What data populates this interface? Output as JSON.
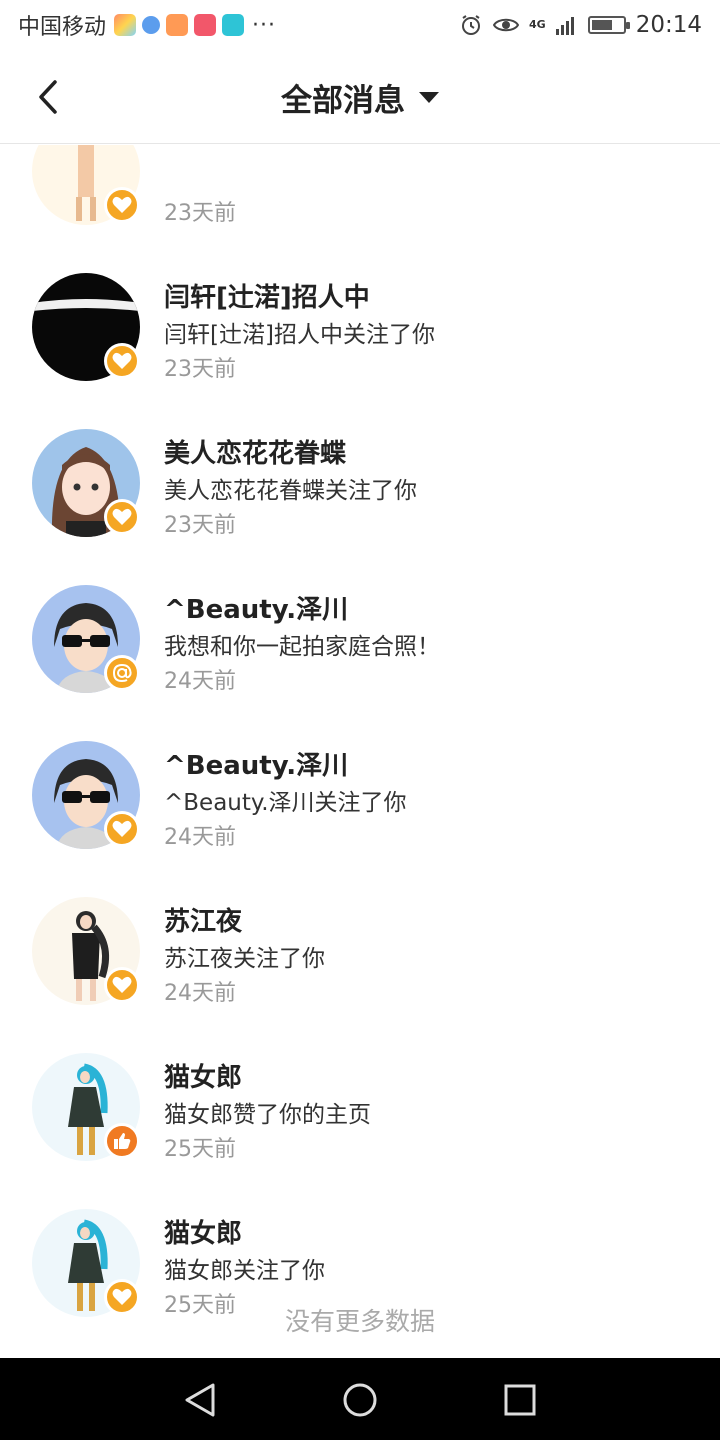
{
  "status_bar": {
    "carrier": "中国移动",
    "more": "···",
    "network": "4G",
    "time": "20:14",
    "battery_level": 0.6
  },
  "header": {
    "title": "全部消息"
  },
  "messages": [
    {
      "name": "",
      "desc": "",
      "time": "23天前",
      "badge": "heart",
      "avatar": "figure-light"
    },
    {
      "name": "闫轩[辻渃]招人中",
      "desc": "闫轩[辻渃]招人中关注了你",
      "time": "23天前",
      "badge": "heart",
      "avatar": "dark"
    },
    {
      "name": "美人恋花花眷蝶",
      "desc": "美人恋花花眷蝶关注了你",
      "time": "23天前",
      "badge": "heart",
      "avatar": "girl"
    },
    {
      "name": "^Beauty.泽川",
      "desc": "我想和你一起拍家庭合照！",
      "time": "24天前",
      "badge": "at",
      "avatar": "boy"
    },
    {
      "name": "^Beauty.泽川",
      "desc": "^Beauty.泽川关注了你",
      "time": "24天前",
      "badge": "heart",
      "avatar": "boy"
    },
    {
      "name": "苏江夜",
      "desc": "苏江夜关注了你",
      "time": "24天前",
      "badge": "heart",
      "avatar": "figure-dark"
    },
    {
      "name": "猫女郎",
      "desc": "猫女郎赞了你的主页",
      "time": "25天前",
      "badge": "like",
      "avatar": "figure-teal"
    },
    {
      "name": "猫女郎",
      "desc": "猫女郎关注了你",
      "time": "25天前",
      "badge": "heart",
      "avatar": "figure-teal"
    }
  ],
  "footer": {
    "no_more": "没有更多数据"
  },
  "colors": {
    "badge_orange": "#f5a623",
    "like_orange": "#f07a22",
    "muted": "#999999"
  },
  "icons": {
    "back": "chevron-left-icon",
    "dropdown": "caret-down-icon",
    "heart": "heart-icon",
    "at": "at-icon",
    "like": "thumbs-up-icon"
  }
}
